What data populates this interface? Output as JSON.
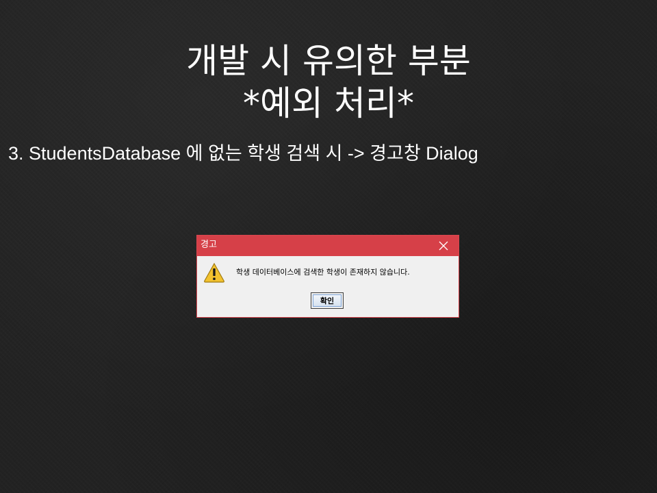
{
  "slide": {
    "title_line1": "개발 시 유의한 부분",
    "title_line2": "*예외 처리*",
    "body": "3. StudentsDatabase 에 없는 학생 검색 시 -> 경고창 Dialog"
  },
  "dialog": {
    "title": "경고",
    "close_icon": "close-icon",
    "warning_icon": "warning-icon",
    "message": "학생 데이터베이스에 검색한 학생이 존재하지 않습니다.",
    "ok_label": "확인",
    "colors": {
      "titlebar": "#d64048",
      "border": "#d9474f",
      "body": "#f0f0f0",
      "warning_fill": "#f2c22e"
    }
  }
}
